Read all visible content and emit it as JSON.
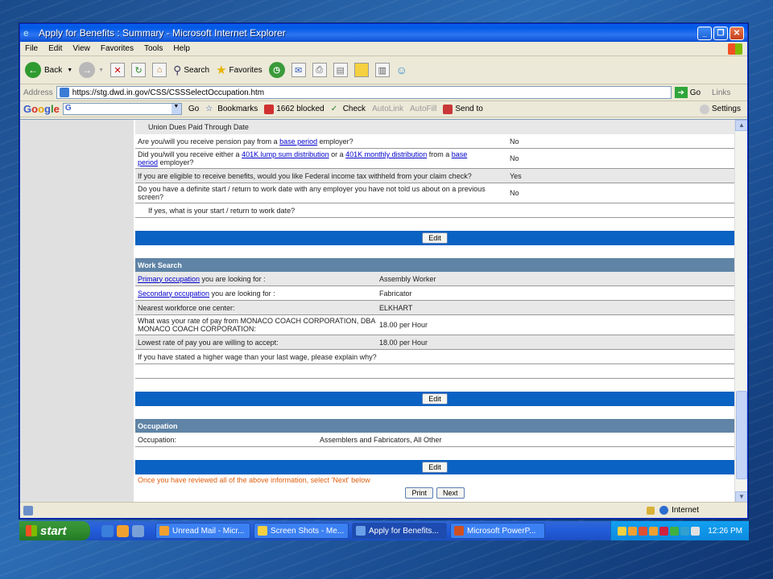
{
  "window": {
    "title": "Apply for Benefits : Summary - Microsoft Internet Explorer"
  },
  "menu": [
    "File",
    "Edit",
    "View",
    "Favorites",
    "Tools",
    "Help"
  ],
  "toolbar": {
    "back": "Back",
    "search": "Search",
    "favorites": "Favorites"
  },
  "address": {
    "label": "Address",
    "url": "https://stg.dwd.in.gov/CSS/CSSSelectOccupation.htm",
    "go": "Go",
    "links": "Links"
  },
  "google": {
    "go": "Go",
    "bookmarks": "Bookmarks",
    "blocked": "1662 blocked",
    "check": "Check",
    "autolink": "AutoLink",
    "autofill": "AutoFill",
    "sendto": "Send to",
    "settings": "Settings"
  },
  "summary": {
    "union_row": "Union Dues Paid Through Date",
    "q_pension_pre": "Are you/will you receive pension pay from a ",
    "q_pension_link": "base period",
    "q_pension_post": " employer?",
    "a_pension": "No",
    "q_401k_pre": "Did you/will you receive either a ",
    "q_401k_link1": "401K lump sum distribution",
    "q_401k_mid": " or a ",
    "q_401k_link2": "401K monthly distribution",
    "q_401k_mid2": " from a ",
    "q_401k_link3a": "base",
    "q_401k_link3b": "period",
    "q_401k_post": " employer?",
    "a_401k": "No",
    "q_tax": "If you are eligible to receive benefits, would you like Federal income tax withheld from your claim check?",
    "a_tax": "Yes",
    "q_start": "Do you have a definite start / return to work date with any employer you have not told us about on a previous screen?",
    "a_start": "No",
    "q_start_date": "If yes, what is your start / return to work date?",
    "edit": "Edit"
  },
  "work_search": {
    "heading": "Work Search",
    "primary_link": "Primary occupation",
    "primary_q": " you are looking for :",
    "primary_a": "Assembly Worker",
    "secondary_link": "Secondary occupation",
    "secondary_q": " you are looking for :",
    "secondary_a": "Fabricator",
    "center_q": "Nearest workforce one center:",
    "center_a": "ELKHART",
    "rate_q": "What was your rate of pay from MONACO COACH CORPORATION, DBA MONACO COACH CORPORATION:",
    "rate_a": "18.00 per Hour",
    "lowest_q": "Lowest rate of pay you are willing to accept:",
    "lowest_a": "18.00 per Hour",
    "higher_q": "If you have stated a higher wage than your last wage, please explain why?",
    "edit": "Edit"
  },
  "occupation": {
    "heading": "Occupation",
    "label": "Occupation:",
    "value": "Assemblers and Fabricators, All Other",
    "edit": "Edit"
  },
  "footer": {
    "note": "Once you have reviewed all of the above information, select 'Next' below",
    "print": "Print",
    "next": "Next"
  },
  "status": {
    "zone": "Internet"
  },
  "taskbar": {
    "start": "start",
    "tasks": [
      "Unread Mail - Micr...",
      "Screen Shots - Me...",
      "Apply for Benefits...",
      "Microsoft PowerP..."
    ],
    "clock": "12:26 PM"
  }
}
